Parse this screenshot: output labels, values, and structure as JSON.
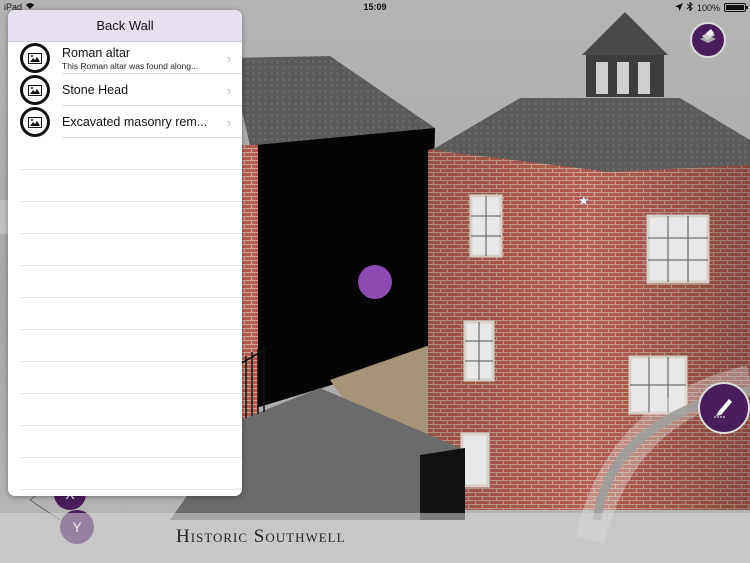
{
  "status_bar": {
    "device": "iPad",
    "time": "15:09",
    "battery_text": "100%",
    "battery_level": 1.0
  },
  "popover": {
    "title": "Back Wall",
    "items": [
      {
        "title": "Roman altar",
        "subtitle": "This Roman altar was found along...",
        "icon": "image-icon"
      },
      {
        "title": "Stone Head",
        "subtitle": "",
        "icon": "image-icon"
      },
      {
        "title": "Excavated masonry rem...",
        "subtitle": "",
        "icon": "image-icon"
      }
    ]
  },
  "buttons": {
    "layers_icon": "layers-icon",
    "edit_icon": "pencil-icon",
    "axis_x_label": "X",
    "axis_y_label": "Y"
  },
  "banner": {
    "title": "Historic Southwell"
  },
  "colors": {
    "accent_purple": "#4b1d5c",
    "pin_purple": "#9c53c4",
    "header_lavender": "#e6e0ef",
    "brick": "#b0574a"
  }
}
